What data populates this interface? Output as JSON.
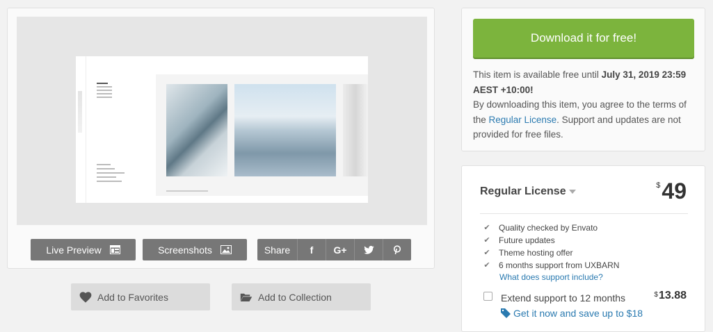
{
  "preview": {
    "live_preview_label": "Live Preview",
    "screenshots_label": "Screenshots",
    "share_label": "Share",
    "share_icons": [
      "facebook-icon",
      "google-plus-icon",
      "twitter-icon",
      "pinterest-icon"
    ],
    "share_glyphs": [
      "f",
      "G+",
      "♥",
      "℗"
    ]
  },
  "actions": {
    "favorites_label": "Add to Favorites",
    "collection_label": "Add to Collection"
  },
  "free": {
    "download_label": "Download it for free!",
    "line1": "This item is available free until ",
    "until_date": "July 31, 2019 23:59 AEST +10:00!",
    "line2": "By downloading this item, you agree to the terms of the ",
    "license_link": "Regular License",
    "line3": ". Support and updates are not provided for free files."
  },
  "license": {
    "title": "Regular License",
    "currency": "$",
    "price": "49",
    "features": [
      "Quality checked by Envato",
      "Future updates",
      "Theme hosting offer",
      "6 months support from UXBARN"
    ],
    "support_link": "What does support include?",
    "extend_label": "Extend support to 12 months",
    "extend_currency": "$",
    "extend_price": "13.88",
    "save_link": "Get it now and save up to $18"
  },
  "colors": {
    "download_green": "#7cb43d",
    "link_blue": "#2a7ab0",
    "button_gray": "#777777"
  }
}
